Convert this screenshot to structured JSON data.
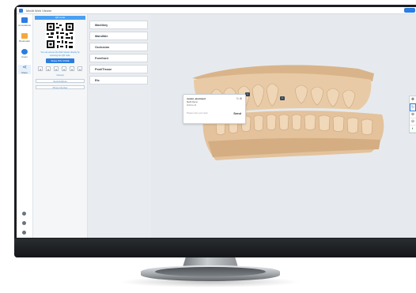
{
  "app": {
    "title": "Medit Web Viewer"
  },
  "nav": {
    "items": [
      {
        "label": "Annotations",
        "icon": "annotation-icon",
        "color": "#2b7de0"
      },
      {
        "label": "Bookmark",
        "icon": "bookmark-icon",
        "color": "#f2a93b"
      },
      {
        "label": "Users",
        "icon": "users-icon",
        "color": "#2b7de0"
      },
      {
        "label": "Share",
        "icon": "share-icon",
        "color": "#2b7de0"
      }
    ],
    "bottom_icons": [
      "settings-icon",
      "home-icon",
      "help-icon"
    ]
  },
  "share_panel": {
    "header": "QR Code",
    "instructions": "You can access the Web Viewer directly by scanning the QR code.",
    "share_button": "Share PIN CODE",
    "pin_digits": [
      "●",
      "●",
      "●",
      "●",
      "●",
      "●"
    ],
    "cancel": "Cancel",
    "send_address": "Send Address",
    "phone_number": "Phone Number"
  },
  "menu": {
    "items": [
      "Maxillary",
      "Mandible",
      "Occlusion",
      "Forefront",
      "Post/Tissue",
      "Etc"
    ]
  },
  "comment": {
    "title": "model_abutment",
    "subtitle": "Medit Demo",
    "meta": "2019-11-20",
    "placeholder": "Please enter your reply",
    "send": "Send"
  },
  "markers": [
    "1",
    "2"
  ],
  "toolbar": {
    "tools": [
      {
        "name": "pan-icon",
        "glyph": "✥",
        "active": false
      },
      {
        "name": "rotate-icon",
        "glyph": "↻",
        "active": true
      },
      {
        "name": "zoom-in-icon",
        "glyph": "⊕",
        "active": false
      },
      {
        "name": "zoom-out-icon",
        "glyph": "⊖",
        "active": false
      },
      {
        "name": "color-icon",
        "glyph": "◐",
        "active": false
      }
    ]
  },
  "colors": {
    "accent": "#2b7de0",
    "teeth": "#e8cba6",
    "gums": "#d9b48a"
  }
}
